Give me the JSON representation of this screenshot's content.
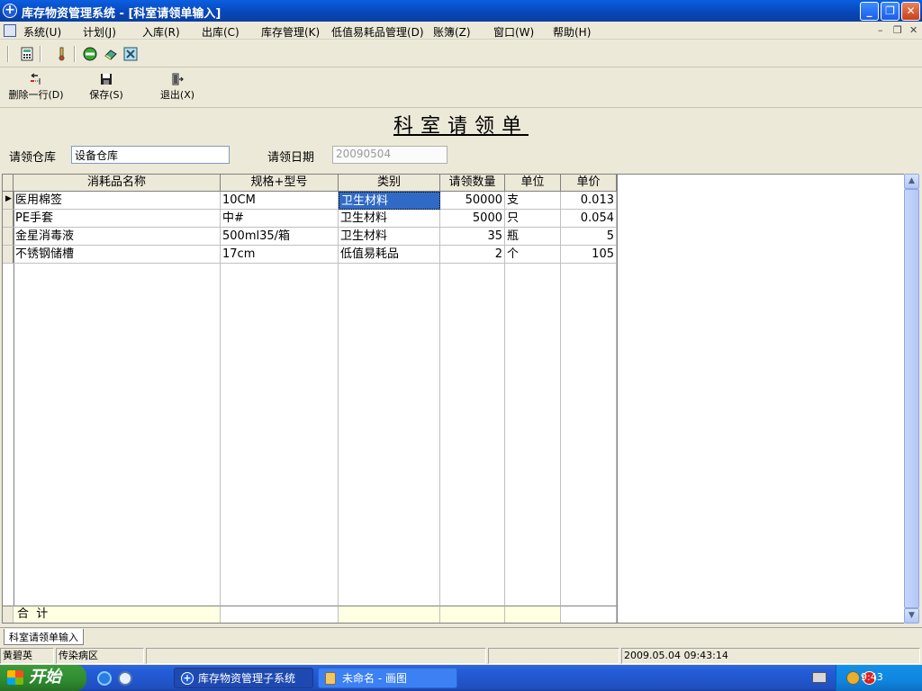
{
  "window": {
    "title": "库存物资管理系统 - [科室请领单输入]"
  },
  "menu": [
    "系统(U)",
    "计划(J)",
    "入库(R)",
    "出库(C)",
    "库存管理(K)",
    "低值易耗品管理(D)",
    "账簿(Z)",
    "窗口(W)",
    "帮助(H)"
  ],
  "actions": {
    "delete_row": "删除一行(D)",
    "save": "保存(S)",
    "exit": "退出(X)"
  },
  "form": {
    "title": "科室请领单",
    "warehouse_label": "请领仓库",
    "warehouse_value": "设备仓库",
    "date_label": "请领日期",
    "date_value": "20090504"
  },
  "grid": {
    "columns": [
      "消耗品名称",
      "规格+型号",
      "类别",
      "请领数量",
      "单位",
      "单价"
    ],
    "rows": [
      {
        "name": "医用棉签",
        "spec": "10CM",
        "category": "卫生材料",
        "qty": "50000",
        "unit": "支",
        "price": "0.013"
      },
      {
        "name": "PE手套",
        "spec": "中#",
        "category": "卫生材料",
        "qty": "5000",
        "unit": "只",
        "price": "0.054"
      },
      {
        "name": "金星消毒液",
        "spec": "500ml35/箱",
        "category": "卫生材料",
        "qty": "35",
        "unit": "瓶",
        "price": "5"
      },
      {
        "name": "不锈钢储槽",
        "spec": "17cm",
        "category": "低值易耗品",
        "qty": "2",
        "unit": "个",
        "price": "105"
      }
    ],
    "total_label": "合  计"
  },
  "tab": {
    "label": "科室请领单输入"
  },
  "status": {
    "user": "黄碧英",
    "dept": "传染病区",
    "datetime": "2009.05.04 09:43:14"
  },
  "taskbar": {
    "start": "开始",
    "tasks": [
      "库存物资管理子系统",
      "未命名 - 画图"
    ],
    "clock": "9:43"
  },
  "colors": {
    "title_blue": "#0a5fe0",
    "selection": "#316ac5",
    "total_row": "#ffffe1"
  }
}
